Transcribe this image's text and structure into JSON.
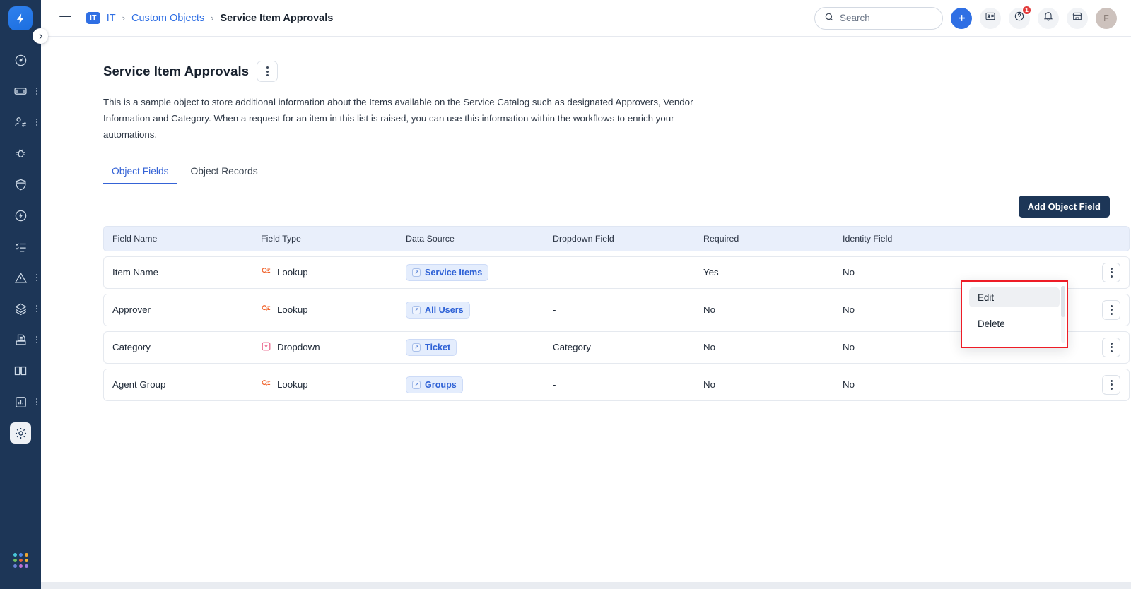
{
  "rail": {
    "logo_icon": "bolt-logo-icon",
    "items": [
      {
        "icon": "dashboard-icon",
        "name": "sidebar-item-dashboard",
        "has_submenu": false,
        "active": false
      },
      {
        "icon": "ticket-icon",
        "name": "sidebar-item-tickets",
        "has_submenu": true,
        "active": false
      },
      {
        "icon": "customers-icon",
        "name": "sidebar-item-customers",
        "has_submenu": true,
        "active": false
      },
      {
        "icon": "bug-icon",
        "name": "sidebar-item-problems",
        "has_submenu": false,
        "active": false
      },
      {
        "icon": "shield-icon",
        "name": "sidebar-item-assets",
        "has_submenu": false,
        "active": false
      },
      {
        "icon": "bolt-circle-icon",
        "name": "sidebar-item-automation",
        "has_submenu": false,
        "active": false
      },
      {
        "icon": "checklist-icon",
        "name": "sidebar-item-tasks",
        "has_submenu": false,
        "active": false
      },
      {
        "icon": "alert-icon",
        "name": "sidebar-item-alerts",
        "has_submenu": true,
        "active": false
      },
      {
        "icon": "layers-icon",
        "name": "sidebar-item-releases",
        "has_submenu": true,
        "active": false
      },
      {
        "icon": "archive-icon",
        "name": "sidebar-item-contracts",
        "has_submenu": true,
        "active": false
      },
      {
        "icon": "book-icon",
        "name": "sidebar-item-solutions",
        "has_submenu": false,
        "active": false
      },
      {
        "icon": "chart-icon",
        "name": "sidebar-item-analytics",
        "has_submenu": true,
        "active": false
      },
      {
        "icon": "gear-icon",
        "name": "sidebar-item-admin",
        "has_submenu": false,
        "active": true
      }
    ],
    "apps_icon": "apps-grid-icon",
    "apps_colors": [
      "#48c6d8",
      "#4f86e8",
      "#f0a830",
      "#6fbf5e",
      "#e2643f",
      "#f2b233",
      "#6a83d6",
      "#c06fd6",
      "#9b7fe0"
    ],
    "expand_icon": "chevron-right-icon"
  },
  "topbar": {
    "menu_icon": "hamburger-menu-icon",
    "breadcrumb": {
      "workspace_badge": "IT",
      "workspace_label": "IT",
      "separator": "›",
      "parent": "Custom Objects",
      "current": "Service Item Approvals"
    },
    "search": {
      "placeholder": "Search",
      "icon": "search-icon"
    },
    "add_button": {
      "icon": "plus-icon",
      "label": "+"
    },
    "contacts_icon": "contact-card-icon",
    "help": {
      "icon": "help-circle-icon",
      "badge": "1"
    },
    "notifications_icon": "bell-icon",
    "marketplace_icon": "store-icon",
    "avatar_initial": "F"
  },
  "page": {
    "title": "Service Item Approvals",
    "kebab_icon": "more-vertical-icon",
    "description": "This is a sample object to store additional information about the Items available on the Service Catalog such as designated Approvers, Vendor Information and Category. When a request for an item in this list is raised, you can use this information within the workflows to enrich your automations.",
    "tabs": [
      {
        "label": "Object Fields",
        "active": true
      },
      {
        "label": "Object Records",
        "active": false
      }
    ],
    "add_field_button": "Add Object Field"
  },
  "table": {
    "columns": [
      "Field Name",
      "Field Type",
      "Data Source",
      "Dropdown Field",
      "Required",
      "Identity Field"
    ],
    "rows": [
      {
        "field_name": "Item Name",
        "field_type": "Lookup",
        "field_type_icon": "lookup-icon",
        "data_source": "Service Items",
        "dropdown_field": "-",
        "required": "Yes",
        "identity_field": "No"
      },
      {
        "field_name": "Approver",
        "field_type": "Lookup",
        "field_type_icon": "lookup-icon",
        "data_source": "All Users",
        "dropdown_field": "-",
        "required": "No",
        "identity_field": "No"
      },
      {
        "field_name": "Category",
        "field_type": "Dropdown",
        "field_type_icon": "dropdown-icon",
        "data_source": "Ticket",
        "dropdown_field": "Category",
        "required": "No",
        "identity_field": "No"
      },
      {
        "field_name": "Agent Group",
        "field_type": "Lookup",
        "field_type_icon": "lookup-icon",
        "data_source": "Groups",
        "dropdown_field": "-",
        "required": "No",
        "identity_field": "No"
      }
    ],
    "row_menu_icon": "more-vertical-icon"
  },
  "context_menu": {
    "items": [
      {
        "label": "Edit",
        "hover": true
      },
      {
        "label": "Delete",
        "hover": false
      }
    ],
    "highlight_color": "#ee1c26"
  },
  "colors": {
    "rail_bg": "#1d3657",
    "accent_blue": "#2f6fe4",
    "link_blue": "#3563d6",
    "primary_btn": "#1d3657",
    "header_row": "#e9effb",
    "chip_bg": "#e4edfd"
  }
}
